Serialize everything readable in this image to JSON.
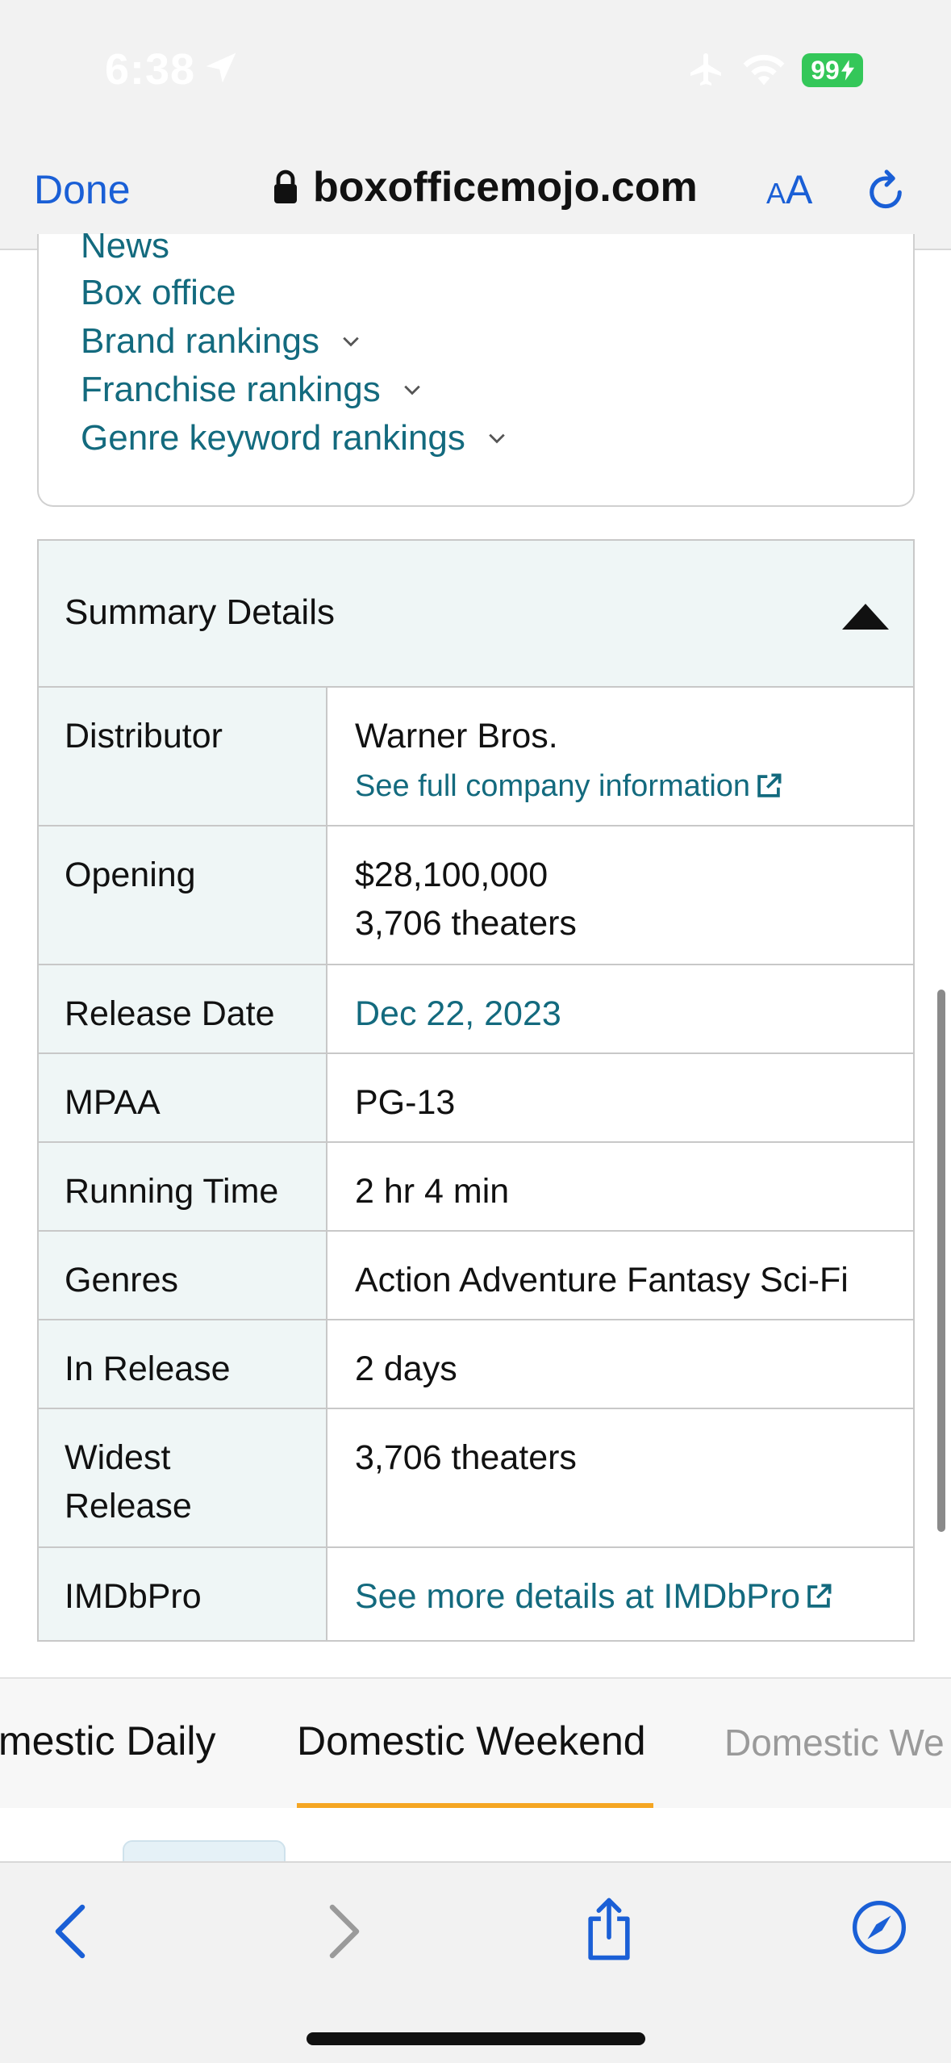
{
  "status_bar": {
    "time": "6:38",
    "battery": "99"
  },
  "toolbar": {
    "done_label": "Done",
    "url": "boxofficemojo.com",
    "text_size_small": "A",
    "text_size_large": "A"
  },
  "nav": {
    "items": [
      {
        "label": "News",
        "has_dropdown": false
      },
      {
        "label": "Box office",
        "has_dropdown": false
      },
      {
        "label": "Brand rankings",
        "has_dropdown": true
      },
      {
        "label": "Franchise rankings",
        "has_dropdown": true
      },
      {
        "label": "Genre keyword rankings",
        "has_dropdown": true
      }
    ]
  },
  "summary": {
    "title": "Summary Details",
    "rows": {
      "distributor": {
        "label": "Distributor",
        "value": "Warner Bros.",
        "link": "See full company information"
      },
      "opening": {
        "label": "Opening",
        "value": "$28,100,000",
        "value2": "3,706 theaters"
      },
      "release_date": {
        "label": "Release Date",
        "value": "Dec 22, 2023"
      },
      "mpaa": {
        "label": "MPAA",
        "value": "PG-13"
      },
      "running_time": {
        "label": "Running Time",
        "value": "2 hr 4 min"
      },
      "genres": {
        "label": "Genres",
        "value": "Action Adventure Fantasy Sci-Fi"
      },
      "in_release": {
        "label": "In Release",
        "value": "2 days"
      },
      "widest_release": {
        "label": "Widest Release",
        "label_line1": "Widest",
        "label_line2": "Release",
        "value": "3,706 theaters"
      },
      "imdbpro": {
        "label": "IMDbPro",
        "value": "See more details at IMDbPro"
      }
    }
  },
  "tabs": {
    "items": [
      "mestic Daily",
      "Domestic Weekend",
      "Domestic We"
    ],
    "active_index": 1
  },
  "colors": {
    "link": "#136a7e",
    "ios_blue": "#1a5fd6",
    "active_tab": "#f5a623",
    "battery": "#34c759",
    "table_label_bg": "#eff6f6"
  }
}
